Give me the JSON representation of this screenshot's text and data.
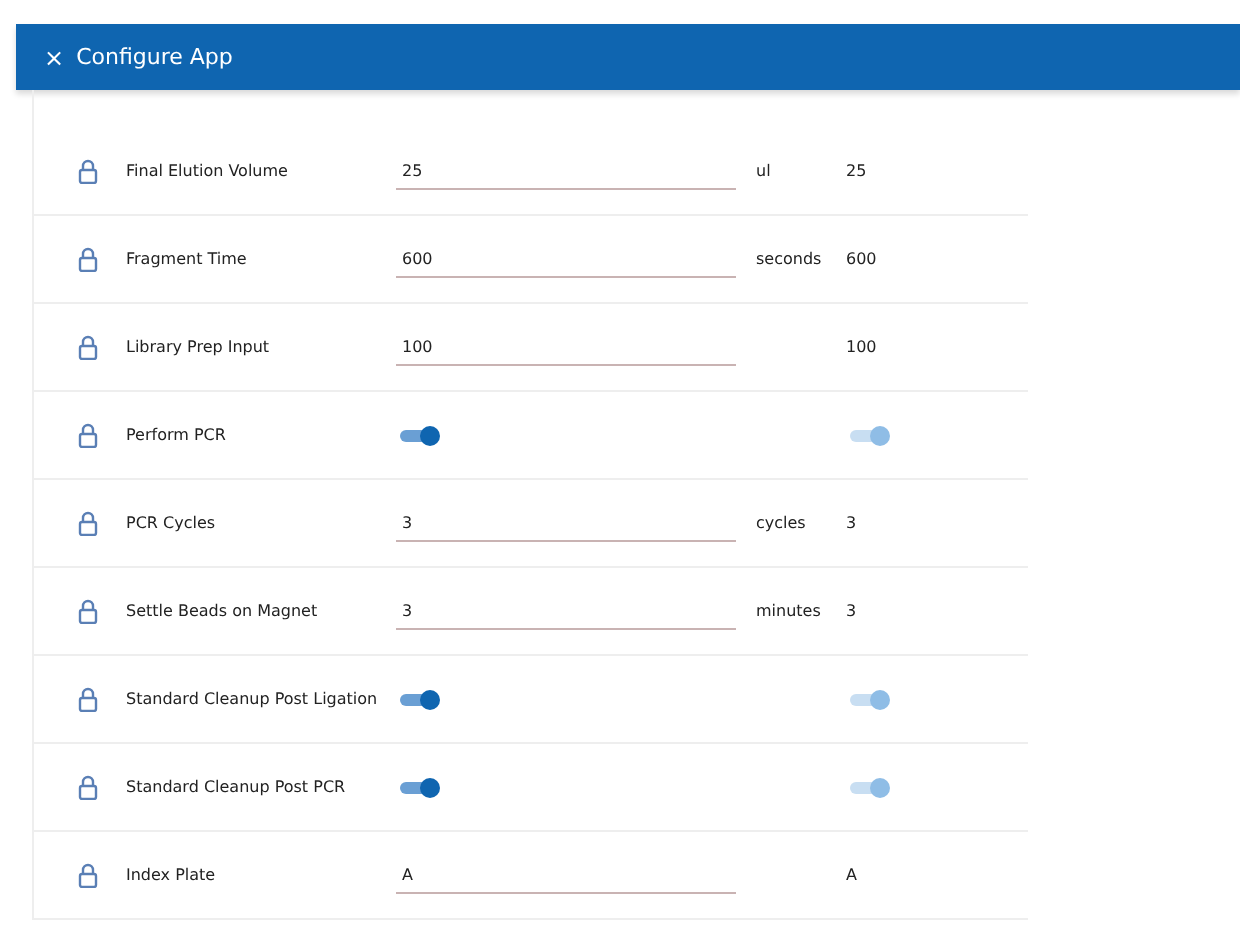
{
  "header": {
    "close": "×",
    "title": "Configure App"
  },
  "rows": [
    {
      "kind": "text",
      "label": "Final Elution Volume",
      "value": "25",
      "unit": "ul",
      "default": "25"
    },
    {
      "kind": "text",
      "label": "Fragment Time",
      "value": "600",
      "unit": "seconds",
      "default": "600"
    },
    {
      "kind": "text",
      "label": "Library Prep Input",
      "value": "100",
      "default": "100"
    },
    {
      "kind": "toggle",
      "label": "Perform PCR",
      "on": true,
      "default_on": true
    },
    {
      "kind": "text",
      "label": "PCR Cycles",
      "value": "3",
      "unit": "cycles",
      "default": "3"
    },
    {
      "kind": "text",
      "label": "Settle Beads on Magnet",
      "value": "3",
      "unit": "minutes",
      "default": "3"
    },
    {
      "kind": "toggle",
      "label": "Standard Cleanup Post Ligation",
      "on": true,
      "default_on": true
    },
    {
      "kind": "toggle",
      "label": "Standard Cleanup Post PCR",
      "on": true,
      "default_on": true
    },
    {
      "kind": "text",
      "label": "Index Plate",
      "value": "A",
      "default": "A"
    }
  ]
}
